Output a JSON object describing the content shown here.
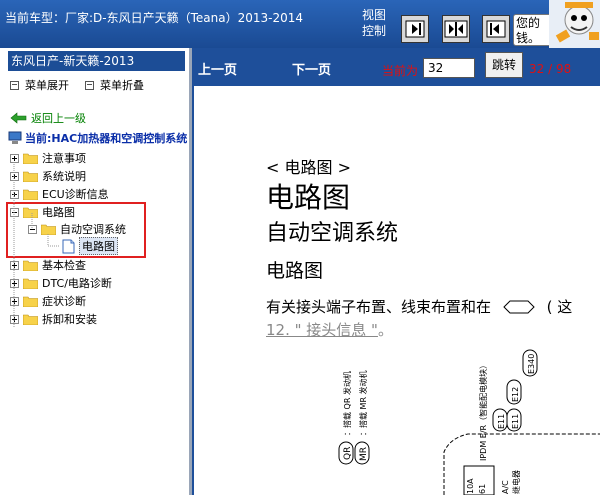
{
  "header": {
    "vehicle_title": "当前车型：厂家:D-东风日产天籁（Teana）2013-2014",
    "view_label": "视图控制",
    "help_text": "您的 钱。"
  },
  "sidebar": {
    "title": "东风日产-新天籁-2013",
    "expand_all": "菜单展开",
    "collapse_all": "菜单折叠",
    "back_link": "返回上一级",
    "current": "当前:HAC加热器和空调控制系统",
    "items": [
      {
        "label": "注意事项"
      },
      {
        "label": "系统说明"
      },
      {
        "label": "ECU诊断信息"
      },
      {
        "label": "电路图"
      },
      {
        "label": "自动空调系统"
      },
      {
        "label": "电路图"
      },
      {
        "label": "基本检查"
      },
      {
        "label": "DTC/电路诊断"
      },
      {
        "label": "症状诊断"
      },
      {
        "label": "拆卸和安装"
      }
    ]
  },
  "toolbar": {
    "prev_page": "上一页",
    "next_page": "下一页",
    "current_label": "当前为",
    "page_value": "32",
    "jump_label": "跳转",
    "page_count": "32 / 98"
  },
  "document": {
    "crumb": "< 电路图 >",
    "title": "电路图",
    "subtitle": "自动空调系统",
    "section": "电路图",
    "para": "有关接头端子布置、线束布置和在",
    "para_tail": "( 这",
    "link_text": "12. \" 接头信息 \"",
    "link_suffix": "。",
    "diagram": {
      "left_labels": [
        "QR",
        "MR"
      ],
      "left_texts": [
        "：搭载 QR 发动机",
        "：搭载 MR 发动机"
      ],
      "connectors": [
        "E340",
        "E12",
        "E11",
        "E11"
      ],
      "module_text": "IPDM E/R（智能配电模块）",
      "bottom_labels": [
        "10A",
        "61",
        "A/C",
        "继电器"
      ]
    }
  },
  "colors": {
    "brand_blue": "#1e4f9a",
    "highlight_red": "#e02020",
    "page_red": "#e01010",
    "back_green": "#008000",
    "current_blue": "#0a2ea8"
  }
}
